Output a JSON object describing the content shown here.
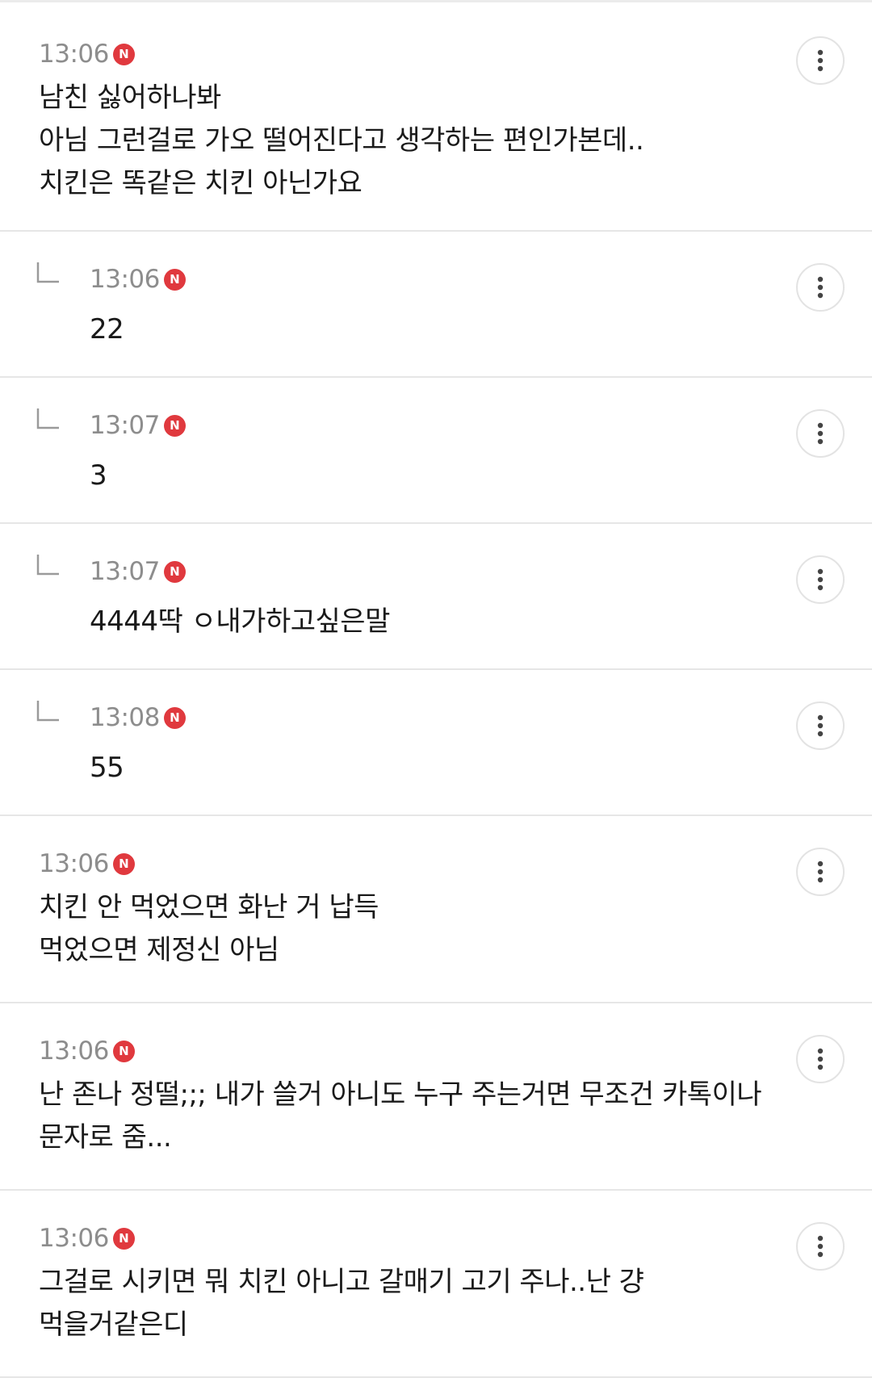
{
  "comments": [
    {
      "time": "13:06",
      "badge": "N",
      "text": "남친 싫어하나봐\n아님 그런걸로 가오 떨어진다고 생각하는 편인가본데..\n치킨은 똑같은 치킨 아닌가요",
      "is_reply": false
    },
    {
      "time": "13:06",
      "badge": "N",
      "text": "22",
      "is_reply": true
    },
    {
      "time": "13:07",
      "badge": "N",
      "text": "3",
      "is_reply": true
    },
    {
      "time": "13:07",
      "badge": "N",
      "text": "4444딱 ㅇ내가하고싶은말",
      "is_reply": true
    },
    {
      "time": "13:08",
      "badge": "N",
      "text": "55",
      "is_reply": true
    },
    {
      "time": "13:06",
      "badge": "N",
      "text": "치킨 안 먹었으면 화난 거 납득\n먹었으면 제정신 아님",
      "is_reply": false
    },
    {
      "time": "13:06",
      "badge": "N",
      "text": "난 존나 정떨;;; 내가 쓸거 아니도 누구 주는거면 무조건 카톡이나\n문자로 줌...",
      "is_reply": false
    },
    {
      "time": "13:06",
      "badge": "N",
      "text": "그걸로 시키면 뭐 치킨 아니고 갈매기 고기 주나..난 걍\n먹을거같은디",
      "is_reply": false
    }
  ],
  "icons": {
    "more": "more-vertical-icon",
    "reply": "reply-arrow-icon",
    "new": "new-badge-icon"
  },
  "colors": {
    "badge": "#e0393e",
    "time": "#8d8d8d",
    "divider": "#e6e6e6",
    "text": "#1a1a1a"
  }
}
